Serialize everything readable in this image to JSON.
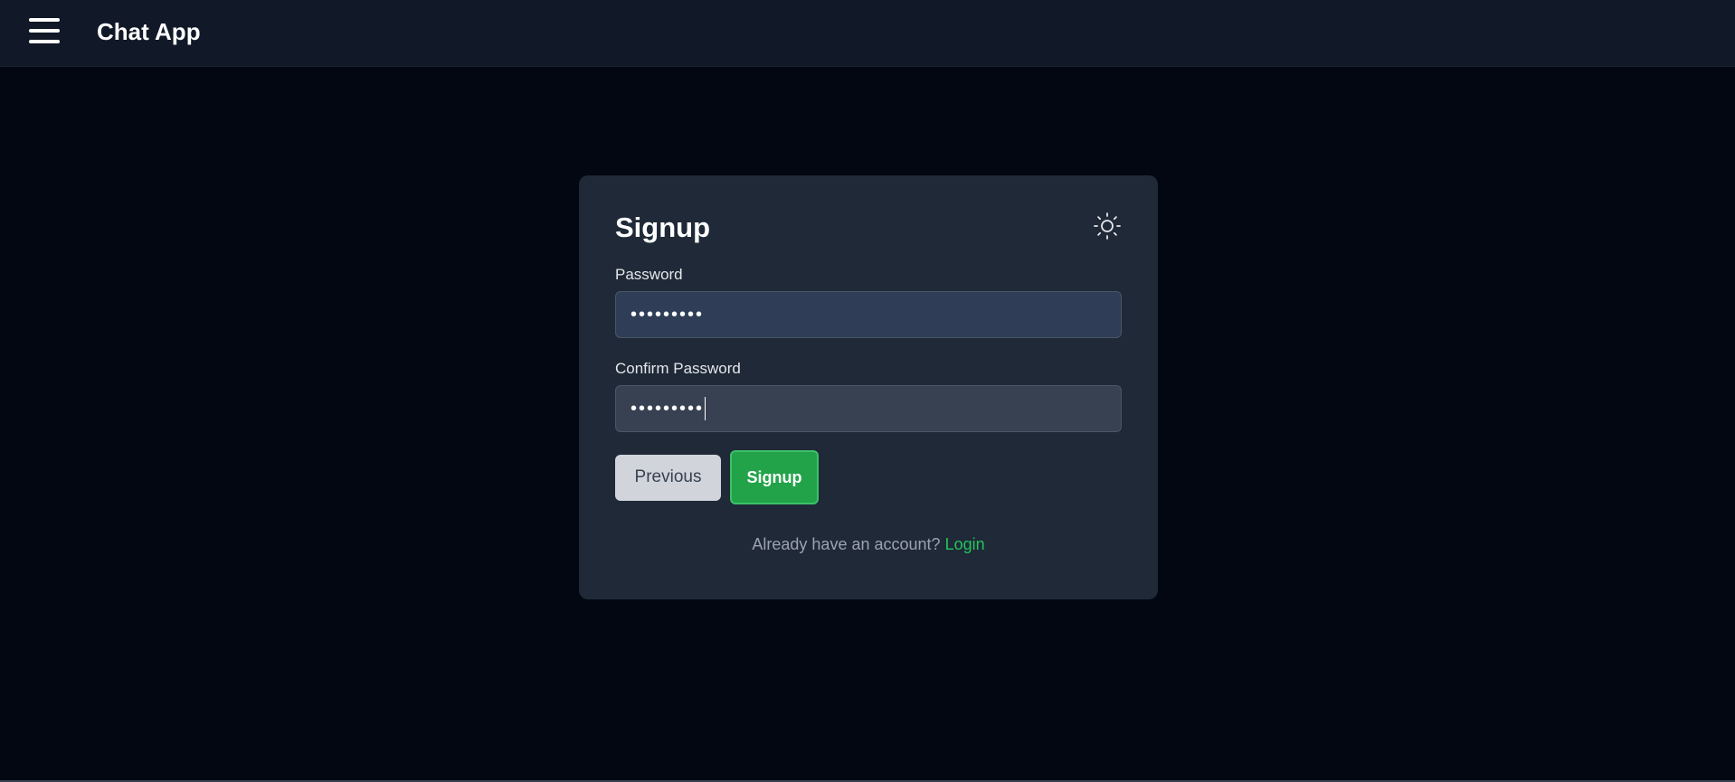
{
  "header": {
    "app_title": "Chat App",
    "menu_icon": "hamburger-menu-icon"
  },
  "form": {
    "title": "Signup",
    "theme_icon": "sun-icon",
    "password": {
      "label": "Password",
      "value": "•••••••••"
    },
    "confirm_password": {
      "label": "Confirm Password",
      "value": "•••••••••"
    },
    "previous_label": "Previous",
    "signup_label": "Signup",
    "footer_text": "Already have an account?",
    "login_label": "Login"
  },
  "colors": {
    "background": "#030712",
    "card": "#1f2937",
    "accent": "#22c55e",
    "signup_button": "#22a34a"
  }
}
